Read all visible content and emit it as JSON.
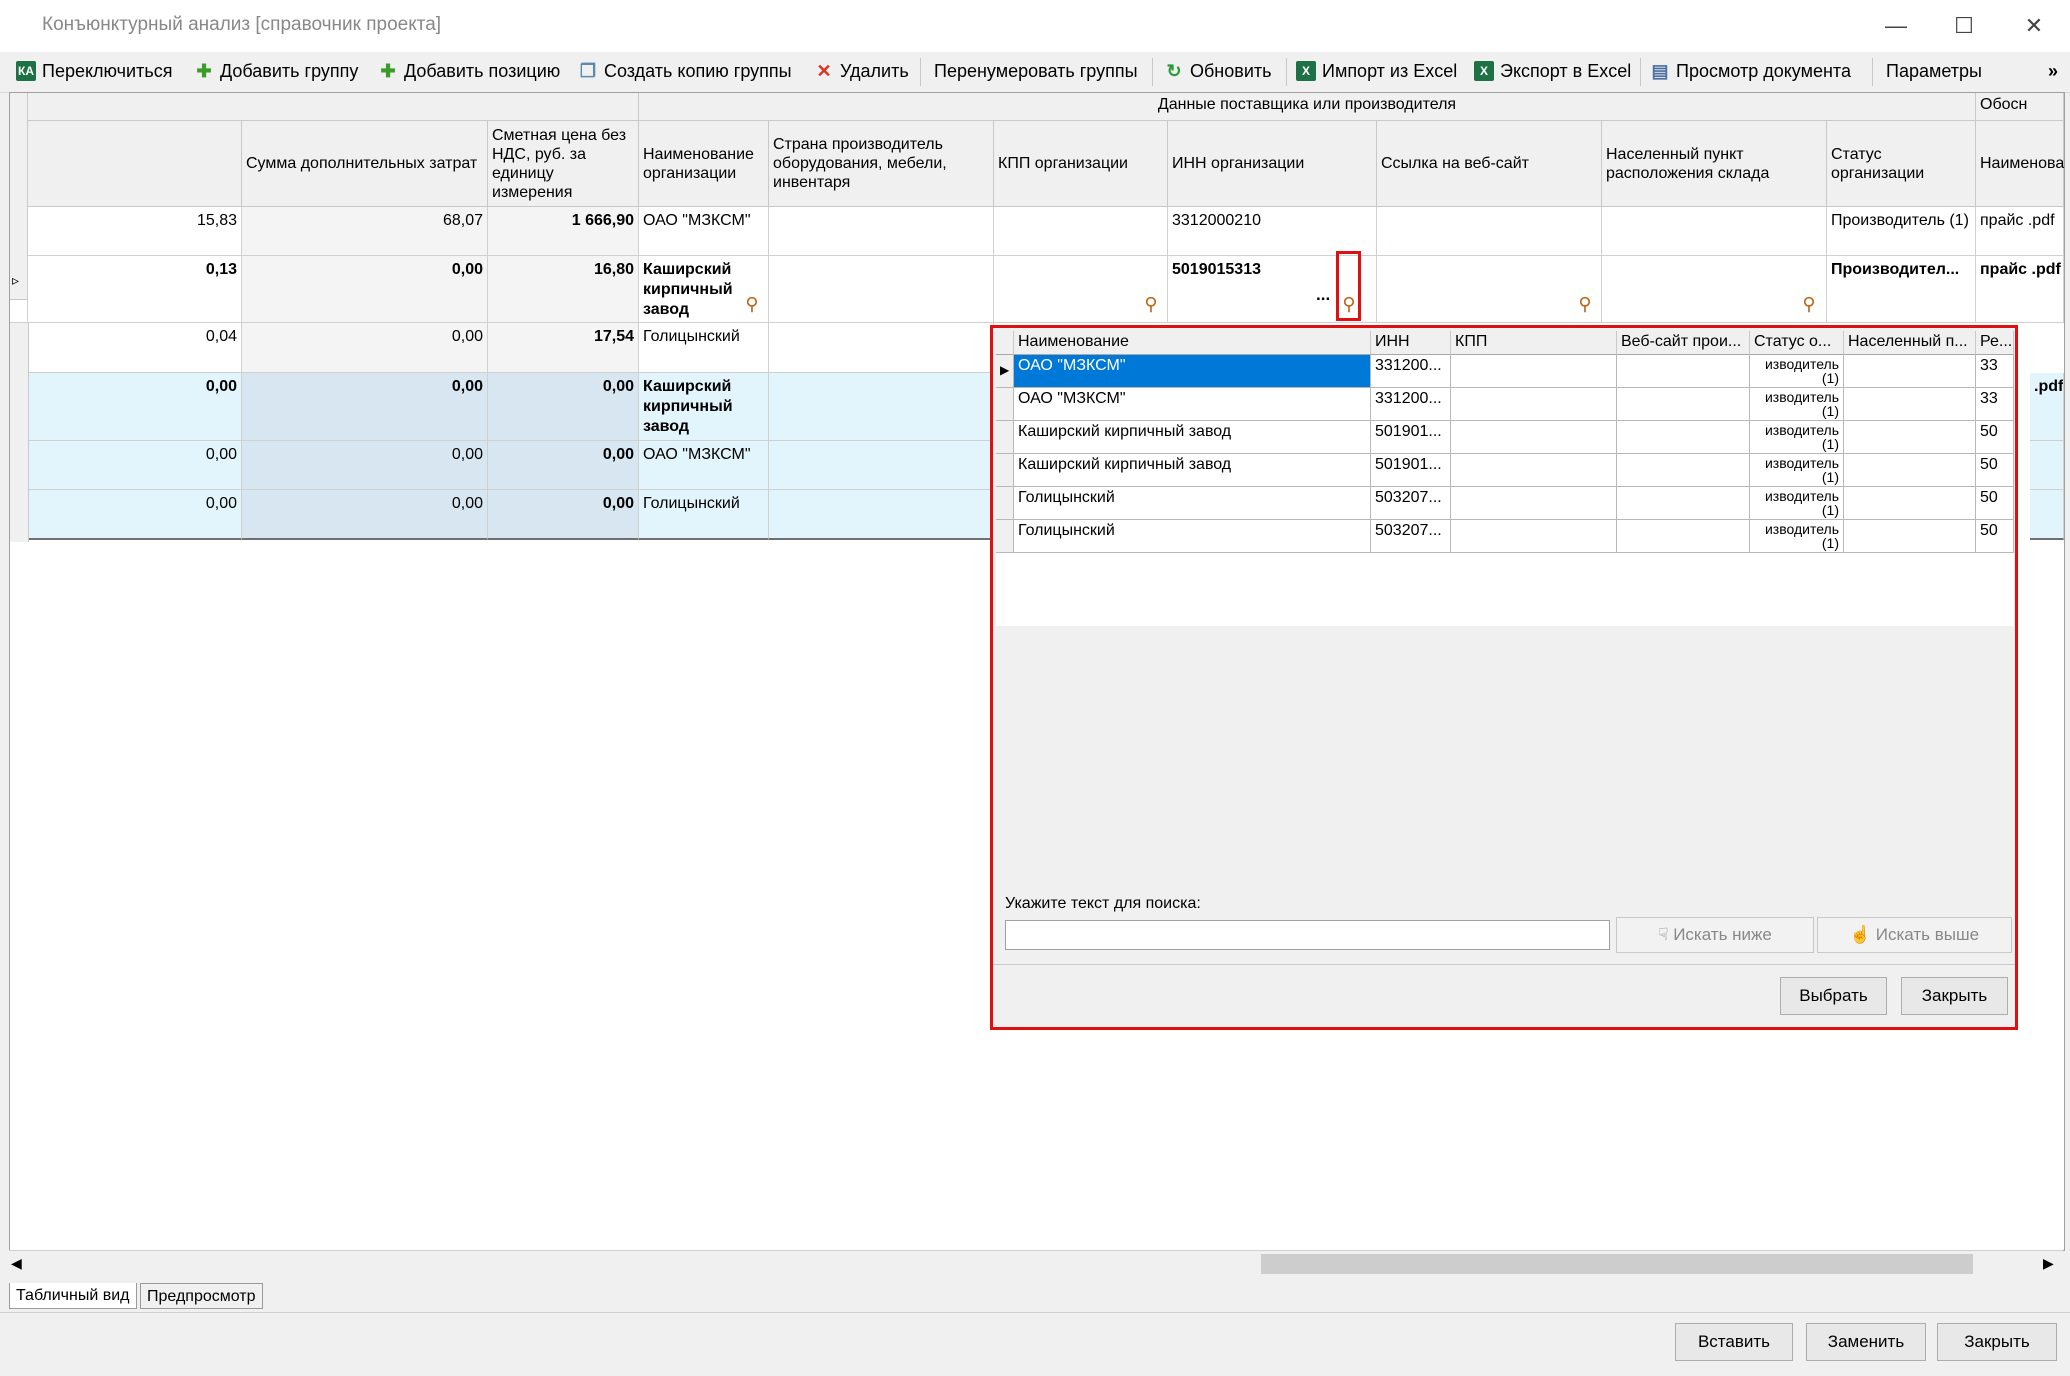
{
  "window": {
    "title": "Конъюнктурный анализ [справочник проекта]",
    "controls": [
      "—",
      "☐",
      "✕"
    ]
  },
  "toolbar": {
    "switch": "Переключиться",
    "add_group": "Добавить группу",
    "add_position": "Добавить позицию",
    "copy_group": "Создать копию группы",
    "delete": "Удалить",
    "renumber": "Перенумеровать группы",
    "refresh": "Обновить",
    "import_excel": "Импорт из Excel",
    "export_excel": "Экспорт в Excel",
    "view_doc": "Просмотр документа",
    "params": "Параметры",
    "more": "»"
  },
  "grid": {
    "group_header": "Данные поставщика или производителя",
    "group_header_right": "Обосн",
    "columns": {
      "extra_costs": "Сумма дополнительных затрат",
      "est_price": "Сметная цена без НДС, руб. за единицу измерения",
      "org_name": "Наименование организации",
      "country": "Страна производитель оборудования, мебели, инвентаря",
      "kpp": "КПП организации",
      "inn": "ИНН организации",
      "website": "Ссылка на веб-сайт",
      "locality": "Населенный пункт расположения склада",
      "status": "Статус организации",
      "name_right": "Наименован"
    },
    "rows": [
      {
        "c0": "15,83",
        "c1": "68,07",
        "c2": "1 666,90",
        "org": "ОАО \"МЗКСМ\"",
        "inn": "3312000210",
        "status": "Производитель (1)",
        "name": "прайс .pdf"
      },
      {
        "c0": "0,13",
        "c1": "0,00",
        "c2": "16,80",
        "org": "Каширский кирпичный завод",
        "inn": "5019015313",
        "status": "Производител...",
        "name": "прайс .pdf"
      },
      {
        "c0": "0,04",
        "c1": "0,00",
        "c2": "17,54",
        "org": "Голицынский"
      },
      {
        "c0": "0,00",
        "c1": "0,00",
        "c2": "0,00",
        "org": "Каширский кирпичный завод",
        "name": ".pdf"
      },
      {
        "c0": "0,00",
        "c1": "0,00",
        "c2": "0,00",
        "org": "ОАО \"МЗКСМ\""
      },
      {
        "c0": "0,00",
        "c1": "0,00",
        "c2": "0,00",
        "org": "Голицынский"
      }
    ],
    "ellipsis": "..."
  },
  "popup": {
    "headers": [
      "Наименование",
      "ИНН",
      "КПП",
      "Веб-сайт прои...",
      "Статус о...",
      "Населенный п...",
      "Ре..."
    ],
    "rows": [
      {
        "name": "ОАО \"МЗКСМ\"",
        "inn": "331200...",
        "status_l1": "изводитель",
        "status_l2": "(1)",
        "reg": "33"
      },
      {
        "name": "ОАО \"МЗКСМ\"",
        "inn": "331200...",
        "status_l1": "изводитель",
        "status_l2": "(1)",
        "reg": "33"
      },
      {
        "name": "Каширский кирпичный завод",
        "inn": "501901...",
        "status_l1": "изводитель",
        "status_l2": "(1)",
        "reg": "50"
      },
      {
        "name": "Каширский кирпичный завод",
        "inn": "501901...",
        "status_l1": "изводитель",
        "status_l2": "(1)",
        "reg": "50"
      },
      {
        "name": "Голицынский",
        "inn": "503207...",
        "status_l1": "изводитель",
        "status_l2": "(1)",
        "reg": "50"
      },
      {
        "name": "Голицынский",
        "inn": "503207...",
        "status_l1": "изводитель",
        "status_l2": "(1)",
        "reg": "50"
      }
    ],
    "search_label": "Укажите текст для поиска:",
    "search_value": "",
    "search_down": "Искать ниже",
    "search_up": "Искать выше",
    "select": "Выбрать",
    "close": "Закрыть"
  },
  "tabs": {
    "table": "Табличный вид",
    "preview": "Предпросмотр"
  },
  "footer": {
    "insert": "Вставить",
    "replace": "Заменить",
    "close": "Закрыть"
  },
  "colors": {
    "selection": "#0078d7",
    "highlight_border": "#e01010",
    "group_row": "#e2f4fc"
  }
}
